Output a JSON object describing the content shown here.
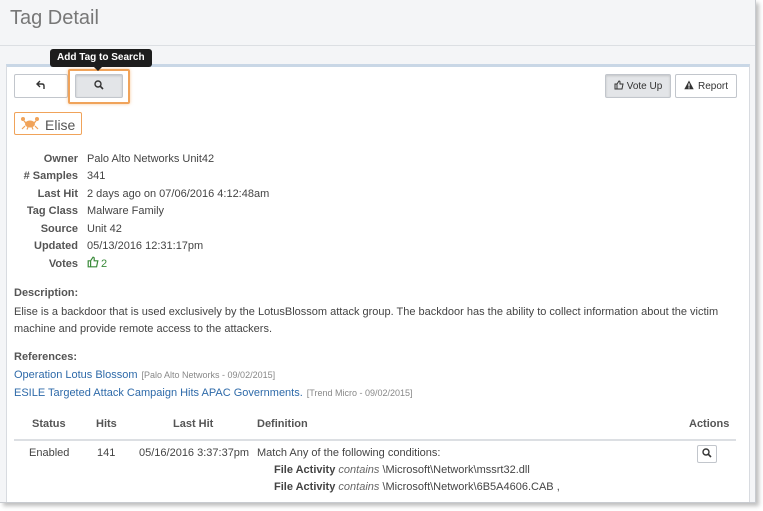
{
  "page": {
    "title": "Tag Detail"
  },
  "toolbar": {
    "back_icon": "back-arrow-icon",
    "search_icon": "search-icon",
    "tooltip": "Add Tag to Search",
    "vote_up_label": "Vote Up",
    "report_label": "Report"
  },
  "tag": {
    "name": "Elise",
    "icon": "crab-icon",
    "color": "#f0a35a"
  },
  "info": {
    "rows": [
      {
        "label": "Owner",
        "value": "Palo Alto Networks Unit42"
      },
      {
        "label": "# Samples",
        "value": "341"
      },
      {
        "label": "Last Hit",
        "value": "2 days ago on 07/06/2016 4:12:48am"
      },
      {
        "label": "Tag Class",
        "value": "Malware Family"
      },
      {
        "label": "Source",
        "value": "Unit 42"
      },
      {
        "label": "Updated",
        "value": "05/13/2016 12:31:17pm"
      }
    ],
    "votes_label": "Votes",
    "votes_value": "2"
  },
  "description": {
    "heading": "Description:",
    "text": "Elise is a backdoor that is used exclusively by the LotusBlossom attack group. The backdoor has the ability to collect information about the victim machine and provide remote access to the attackers."
  },
  "references": {
    "heading": "References:",
    "items": [
      {
        "title": "Operation Lotus Blossom",
        "source": "[Palo Alto Networks - 09/02/2015]"
      },
      {
        "title": "ESILE Targeted Attack Campaign Hits APAC Governments.",
        "source": "[Trend Micro - 09/02/2015]"
      }
    ]
  },
  "table": {
    "headers": [
      "Status",
      "Hits",
      "Last Hit",
      "Definition",
      "Actions"
    ],
    "rows": [
      {
        "status": "Enabled",
        "hits": "141",
        "last_hit": "05/16/2016 3:37:37pm",
        "definition_intro": "Match Any of the following conditions:",
        "conditions": [
          {
            "field": "File Activity",
            "op": "contains",
            "value": "\\Microsoft\\Network\\mssrt32.dll"
          },
          {
            "field": "File Activity",
            "op": "contains",
            "value": "\\Microsoft\\Network\\6B5A4606.CAB ,"
          }
        ]
      }
    ]
  },
  "colors": {
    "accent": "#f0a35a",
    "link": "#2e6aa9",
    "vote_green": "#3a8a3a"
  }
}
